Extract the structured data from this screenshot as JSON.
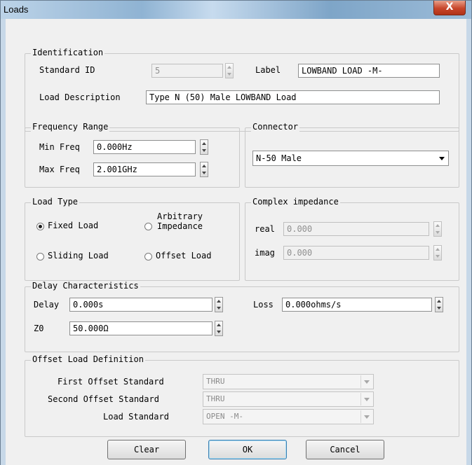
{
  "window": {
    "title": "Loads",
    "close_glyph": "X"
  },
  "identification": {
    "group_label": "Identification",
    "standard_id_label": "Standard ID",
    "standard_id_value": "5",
    "label_label": "Label",
    "label_value": "LOWBAND LOAD -M-",
    "description_label": "Load Description",
    "description_value": "Type N (50) Male LOWBAND Load"
  },
  "frequency_range": {
    "group_label": "Frequency Range",
    "min_label": "Min Freq",
    "min_value": "0.000Hz",
    "max_label": "Max Freq",
    "max_value": "2.001GHz"
  },
  "connector": {
    "group_label": "Connector",
    "selected": "N-50 Male"
  },
  "load_type": {
    "group_label": "Load Type",
    "options": [
      {
        "label": "Fixed Load",
        "selected": true
      },
      {
        "label": "Arbitrary Impedance",
        "line1": "Arbitrary",
        "line2": "Impedance",
        "selected": false
      },
      {
        "label": "Sliding Load",
        "selected": false
      },
      {
        "label": "Offset Load",
        "selected": false
      }
    ]
  },
  "complex_impedance": {
    "group_label": "Complex impedance",
    "real_label": "real",
    "real_value": "0.000",
    "imag_label": "imag",
    "imag_value": "0.000"
  },
  "delay": {
    "group_label": "Delay Characteristics",
    "delay_label": "Delay",
    "delay_value": "0.000s",
    "loss_label": "Loss",
    "loss_value": "0.000ohms/s",
    "z0_label": "Z0",
    "z0_value": "50.000Ω"
  },
  "offset_load": {
    "group_label": "Offset Load Definition",
    "first_label": "First Offset Standard",
    "first_value": "THRU",
    "second_label": "Second Offset Standard",
    "second_value": "THRU",
    "load_std_label": "Load Standard",
    "load_std_value": "OPEN -M-"
  },
  "buttons": {
    "clear": "Clear",
    "ok": "OK",
    "cancel": "Cancel"
  }
}
